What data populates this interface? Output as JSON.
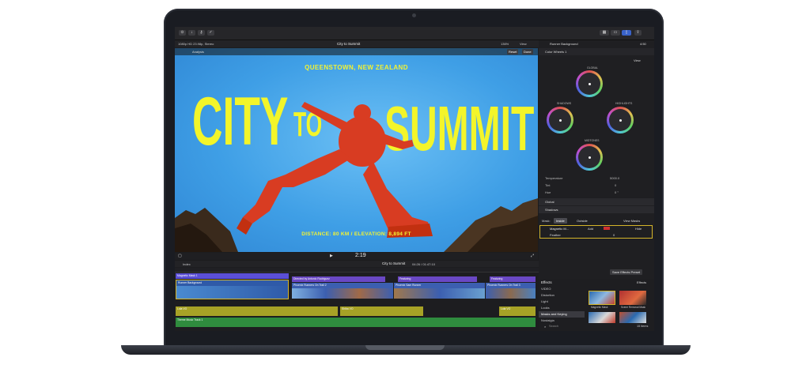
{
  "app": {
    "format_info": "1080p HD 23.98p, Stereo",
    "project_title": "City to Summit",
    "zoom": "136%",
    "view_label": "View",
    "inspector_clip_name": "Runner Background",
    "inspector_duration": "4:50"
  },
  "viewer": {
    "tool_items": [
      "Analysis"
    ],
    "reset_label": "Reset",
    "done_label": "Done",
    "poster_location": "QUEENSTOWN, NEW ZEALAND",
    "poster_title_left": "CITY",
    "poster_title_to": "TO",
    "poster_title_right": "SUMMIT",
    "poster_caption": "DISTANCE: 80 KM / ELEVATION: 8,894 FT",
    "timecode": "2:19"
  },
  "inspector": {
    "effect_name": "Color Wheels 1",
    "view_label": "View",
    "wheels": [
      "GLOBAL",
      "SHADOWS",
      "HIGHLIGHTS",
      "MIDTONES"
    ],
    "params": [
      {
        "label": "Temperature",
        "value": "5000.0"
      },
      {
        "label": "Tint",
        "value": "0"
      },
      {
        "label": "Hue",
        "value": "0 °"
      }
    ],
    "sections": [
      "Global",
      "Shadows"
    ],
    "mask_label": "Mask:",
    "inside_label": "Inside",
    "outside_label": "Outside",
    "view_masks_label": "View Masks",
    "mask_name": "Magnetic M...",
    "add_label": "Add",
    "hide_label": "Hide",
    "feather_label": "Feather",
    "feather_value": "0",
    "save_preset_label": "Save Effects Preset"
  },
  "timeline": {
    "index_label": "Index",
    "project_title": "City to Summit",
    "duration": "04:26 / 01:47:10",
    "clips": [
      {
        "label": "Magnetic Mask 1",
        "color": "#5b4fd6"
      },
      {
        "label": "Runner Background",
        "color": "#2f5aa8"
      },
      {
        "label": "Directed by Antonio Rodriguez",
        "color": "#6a48c4"
      },
      {
        "label": "Featuring",
        "color": "#6a48c4"
      },
      {
        "label": "Featuring",
        "color": "#6a48c4"
      },
      {
        "label": "Phoenix Runners On Trail 2",
        "color": "#3c5fb0"
      },
      {
        "label": "Phoenix Sam Runner",
        "color": "#3c5fb0"
      },
      {
        "label": "Phoenix Runners On Trail 3",
        "color": "#3c5fb0"
      },
      {
        "label": "Lola VO",
        "color": "#a7a226"
      },
      {
        "label": "Shiba VO",
        "color": "#a7a226"
      },
      {
        "label": "Lola VO",
        "color": "#a7a226"
      },
      {
        "label": "Theme Music Track 1",
        "color": "#2f8c3e"
      }
    ]
  },
  "effects": {
    "header": "Effects",
    "header_right": "Effects",
    "categories": [
      "VIDEO",
      "Distortion",
      "Light",
      "Looks",
      "Masks and Keying",
      "Nostalgia"
    ],
    "thumbs": [
      {
        "label": "Magnetic Mask"
      },
      {
        "label": "Scene Removal Mask"
      },
      {
        "label": ""
      },
      {
        "label": ""
      }
    ],
    "search_placeholder": "Search",
    "count": "15 items"
  }
}
